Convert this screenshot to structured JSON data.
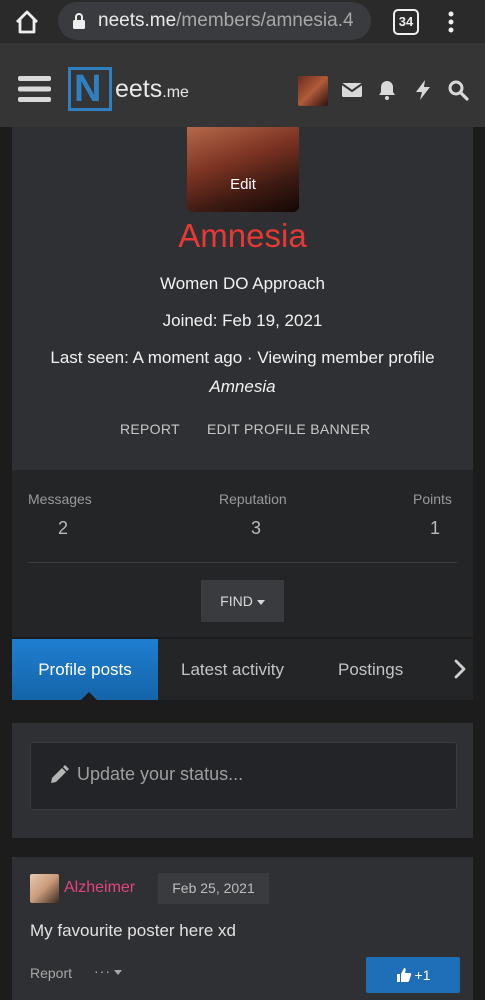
{
  "browser": {
    "url_host": "neets.me",
    "url_path": "/members/amnesia.4",
    "tab_count": "34"
  },
  "site": {
    "logo_letter": "N",
    "logo_rest": "eets",
    "logo_suffix": ".me",
    "header_icons": [
      "envelope-icon",
      "bell-icon",
      "bolt-icon",
      "search-icon"
    ]
  },
  "profile": {
    "avatar_edit_label": "Edit",
    "username": "Amnesia",
    "custom_title": "Women DO Approach",
    "joined": "Joined: Feb 19, 2021",
    "last_seen": "Last seen: A moment ago · Viewing member profile",
    "viewing_name": "Amnesia",
    "actions": {
      "report": "REPORT",
      "edit_banner": "EDIT PROFILE BANNER"
    }
  },
  "stats": {
    "messages": {
      "label": "Messages",
      "value": "2"
    },
    "reputation": {
      "label": "Reputation",
      "value": "3"
    },
    "points": {
      "label": "Points",
      "value": "1"
    },
    "find_label": "FIND"
  },
  "tabs": [
    {
      "label": "Profile posts",
      "active": true
    },
    {
      "label": "Latest activity",
      "active": false
    },
    {
      "label": "Postings",
      "active": false
    }
  ],
  "status": {
    "placeholder": "Update your status..."
  },
  "post": {
    "author": "Alzheimer",
    "date": "Feb 25, 2021",
    "body": "My favourite poster here xd",
    "report": "Report",
    "more": "···",
    "like": "+1"
  },
  "colors": {
    "accent_blue": "#1f7ed1",
    "username_red": "#e53935",
    "author_pink": "#e0457b"
  }
}
